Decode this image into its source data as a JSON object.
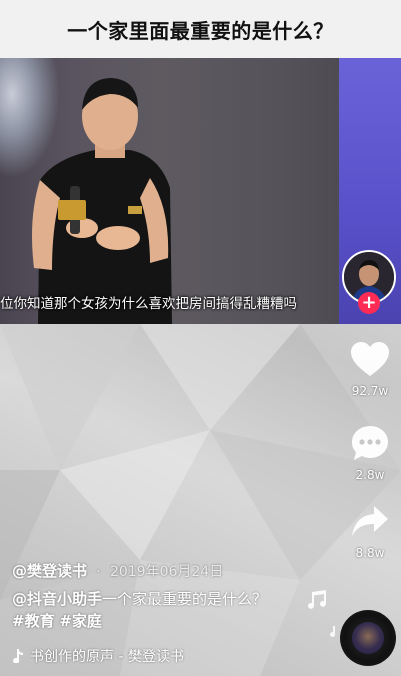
{
  "title": "一个家里面最重要的是什么？",
  "video": {
    "subtitle": "位你知道那个女孩为什么喜欢把房间搞得乱糟糟吗"
  },
  "actions": {
    "like_count": "92.7w",
    "comment_count": "2.8w",
    "share_count": "8.8w"
  },
  "author": {
    "name": "@樊登读书",
    "separator": "·",
    "date": "2019年06月24日"
  },
  "description": {
    "mention": "@抖音小助手",
    "text": "一个家最重要的是什么？",
    "tags": [
      "#教育",
      "#家庭"
    ]
  },
  "music": {
    "label": "书创作的原声 - 樊登读书"
  },
  "colors": {
    "follow": "#fe2c55",
    "title_bg": "#f1f1f1",
    "video_screen": "#5a52cc"
  },
  "icons": {
    "like": "heart-icon",
    "comment": "comment-icon",
    "share": "share-arrow-icon",
    "music": "music-note-icon",
    "follow": "plus-icon"
  }
}
